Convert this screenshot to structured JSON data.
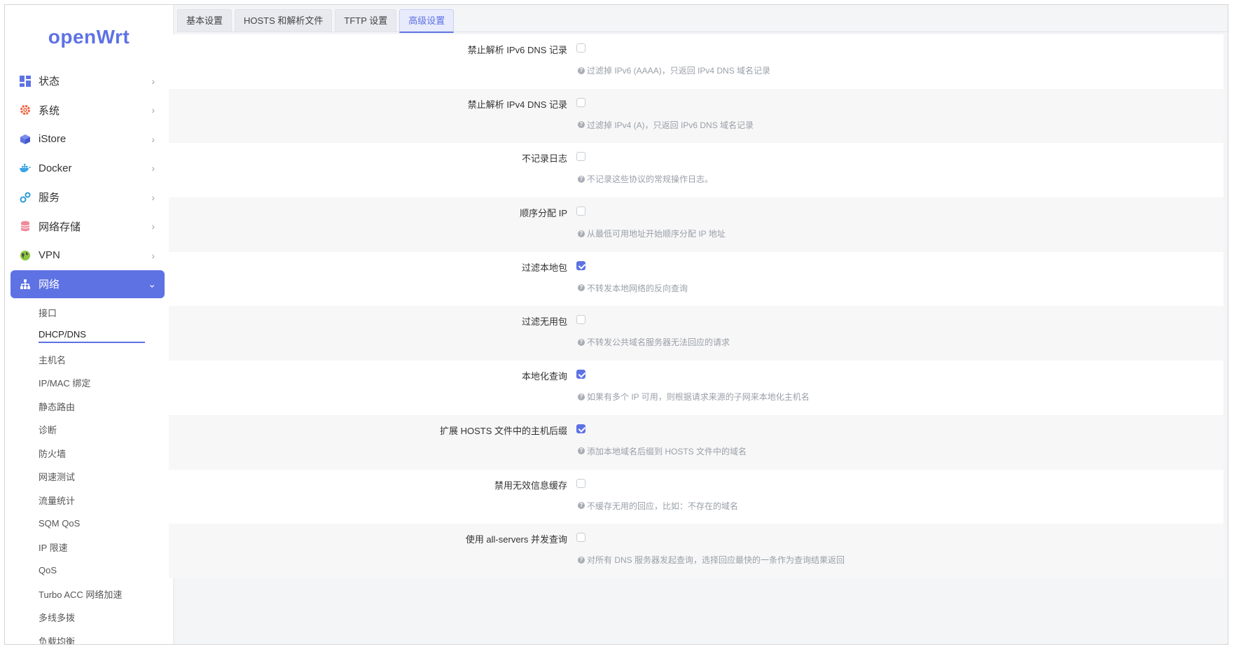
{
  "app": {
    "logo": "openWrt",
    "accent": "#5e72e4"
  },
  "sidebar": {
    "items": [
      {
        "label": "状态",
        "icon": "dashboard-icon"
      },
      {
        "label": "系统",
        "icon": "gear-icon"
      },
      {
        "label": "iStore",
        "icon": "cube-icon"
      },
      {
        "label": "Docker",
        "icon": "docker-icon"
      },
      {
        "label": "服务",
        "icon": "puzzle-icon"
      },
      {
        "label": "网络存储",
        "icon": "database-icon"
      },
      {
        "label": "VPN",
        "icon": "globe-icon"
      },
      {
        "label": "网络",
        "icon": "sitemap-icon"
      }
    ],
    "sub_items": [
      "接口",
      "DHCP/DNS",
      "主机名",
      "IP/MAC 绑定",
      "静态路由",
      "诊断",
      "防火墙",
      "网速测试",
      "流量统计",
      "SQM QoS",
      "IP 限速",
      "QoS",
      "Turbo ACC 网络加速",
      "多线多拨",
      "负载均衡"
    ]
  },
  "tabs": [
    "基本设置",
    "HOSTS 和解析文件",
    "TFTP 设置",
    "高级设置"
  ],
  "form": {
    "rows": [
      {
        "label": "禁止解析 IPv6 DNS 记录",
        "checked": false,
        "hint": "过滤掉 IPv6 (AAAA)，只返回 IPv4 DNS 域名记录"
      },
      {
        "label": "禁止解析 IPv4 DNS 记录",
        "checked": false,
        "hint": "过滤掉 IPv4 (A)，只返回 IPv6 DNS 域名记录"
      },
      {
        "label": "不记录日志",
        "checked": false,
        "hint": "不记录这些协议的常规操作日志。"
      },
      {
        "label": "顺序分配 IP",
        "checked": false,
        "hint": "从最低可用地址开始顺序分配 IP 地址"
      },
      {
        "label": "过滤本地包",
        "checked": true,
        "hint": "不转发本地网络的反向查询"
      },
      {
        "label": "过滤无用包",
        "checked": false,
        "hint": "不转发公共域名服务器无法回应的请求"
      },
      {
        "label": "本地化查询",
        "checked": true,
        "hint": "如果有多个 IP 可用，则根据请求来源的子网来本地化主机名"
      },
      {
        "label": "扩展 HOSTS 文件中的主机后缀",
        "checked": true,
        "hint": "添加本地域名后缀到 HOSTS 文件中的域名"
      },
      {
        "label": "禁用无效信息缓存",
        "checked": false,
        "hint": "不缓存无用的回应，比如：不存在的域名"
      },
      {
        "label": "使用 all-servers 并发查询",
        "checked": false,
        "hint": "对所有 DNS 服务器发起查询，选择回应最快的一条作为查询结果返回"
      }
    ]
  }
}
